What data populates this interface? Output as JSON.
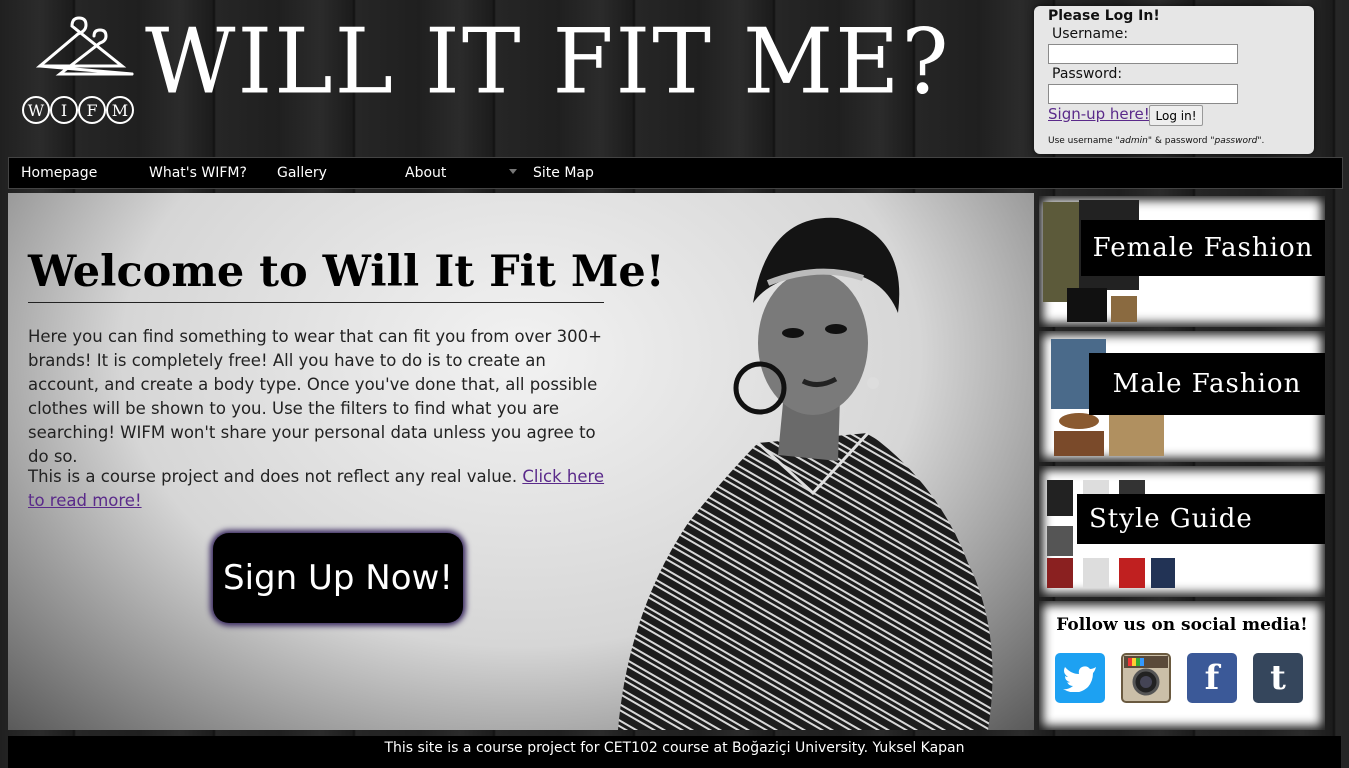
{
  "header": {
    "logo_text": "WIFM",
    "site_title": "WILL IT FIT ME?"
  },
  "login": {
    "title": "Please Log In!",
    "username_label": "Username:",
    "username_value": "",
    "password_label": "Password:",
    "password_value": "",
    "signup_link": "Sign-up here!",
    "login_button": "Log in!",
    "hint_prefix": "Use username \"",
    "hint_user": "admin",
    "hint_mid": "\" & password \"",
    "hint_pass": "password",
    "hint_suffix": "\"."
  },
  "nav": {
    "items": [
      "Homepage",
      "What's WIFM?",
      "Gallery",
      "About",
      "Site Map"
    ]
  },
  "main": {
    "title": "Welcome to Will It Fit Me!",
    "intro": "Here you can find something to wear that can fit you from over 300+ brands! It is completely free! All you have to do is to create an account, and create a body type. Once you've done that, all possible clothes will be shown to you. Use the filters to find what you are searching! WIFM won't share your personal data unless you agree to do so.",
    "note": "This is a course project and does not reflect any real value.",
    "read_more_link": "Click here to read more!",
    "signup_button": "Sign Up Now!"
  },
  "sidebar": {
    "cards": [
      "Female Fashion",
      "Male Fashion",
      "Style Guide"
    ],
    "social_title": "Follow us on social media!",
    "social_icons": [
      "twitter-icon",
      "instagram-icon",
      "facebook-icon",
      "tumblr-icon"
    ]
  },
  "footer": {
    "text": "This site is a course project for CET102 course at Boğaziçi University. Yuksel Kapan"
  },
  "colors": {
    "twitter": "#1da1f2",
    "facebook": "#3b5998",
    "tumblr": "#35465c",
    "link": "#5a2a8a"
  }
}
